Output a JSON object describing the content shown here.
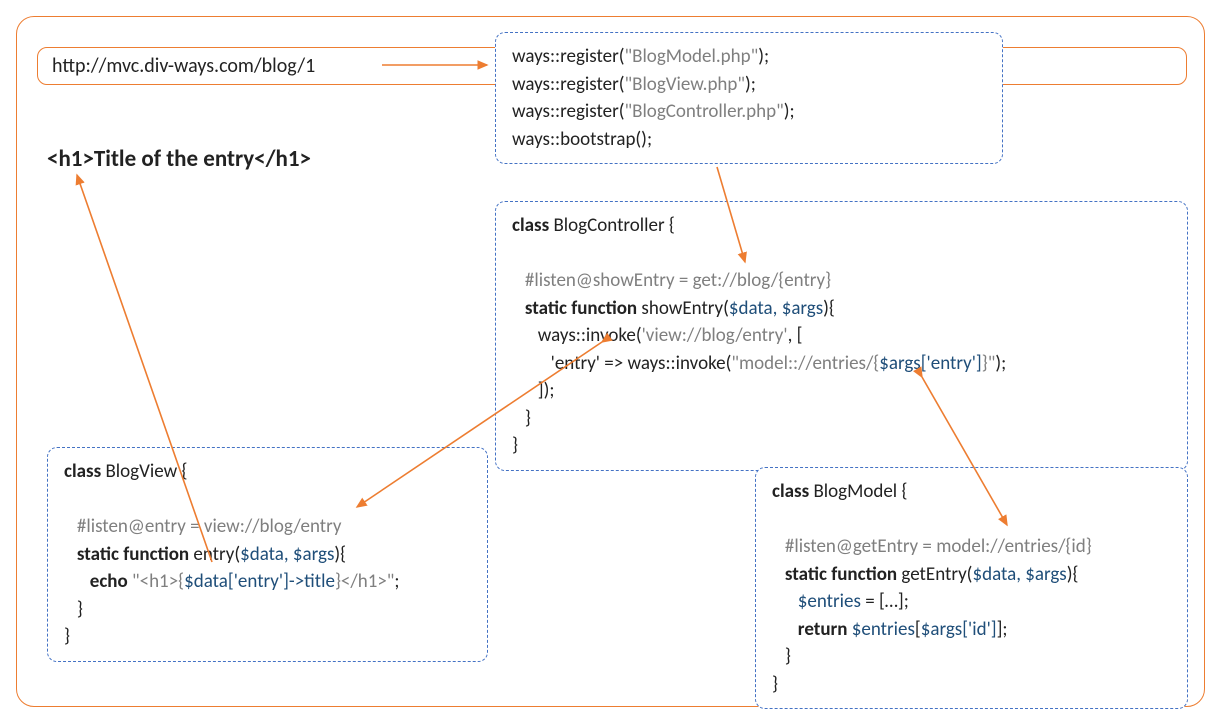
{
  "url": "http://mvc.div-ways.com/blog/1",
  "heading_full": "<h1>Title of the entry</h1>",
  "register": {
    "line1_pre": "ways::register(",
    "line1_str": "\"BlogModel.php\"",
    "line1_post": ");",
    "line2_pre": "ways::register(",
    "line2_str": "\"BlogView.php\"",
    "line2_post": ");",
    "line3_pre": "ways::register(",
    "line3_str": "\"BlogController.php\"",
    "line3_post": ");",
    "line4": "ways::bootstrap();"
  },
  "controller": {
    "class_kw": "class",
    "class_name": " BlogController {",
    "listen": "   #listen@showEntry = get://blog/{entry}",
    "fn_kw": "   static function",
    "fn_sig_plain": " showEntry(",
    "fn_args": "$data, $args",
    "fn_sig_close": "){",
    "invoke1_pre": "      ways::invoke(",
    "invoke1_str": "'view://blog/entry'",
    "invoke1_post": ", [",
    "invoke2_pre": "         'entry' => ways::invoke(",
    "invoke2_str1": "\"model:://entries/{",
    "invoke2_var": "$args['entry']",
    "invoke2_str2": "}\"",
    "invoke2_post": ");",
    "close1": "      ]);",
    "close2": "   }",
    "close3": "}"
  },
  "view": {
    "class_kw": "class",
    "class_name": " BlogView {",
    "listen": "   #listen@entry = view://blog/entry",
    "fn_kw": "   static function",
    "fn_name": " entry(",
    "fn_args": "$data, $args",
    "fn_close": "){",
    "echo_kw": "      echo ",
    "echo_str1": "\"<h1>{",
    "echo_var": "$data['entry']->title",
    "echo_str2": "}</h1>\"",
    "echo_post": ";",
    "close1": "   }",
    "close2": "}"
  },
  "model": {
    "class_kw": "class",
    "class_name": " BlogModel {",
    "listen": "   #listen@getEntry = model://entries/{id}",
    "fn_kw": "   static function",
    "fn_name": " getEntry(",
    "fn_args": "$data, $args",
    "fn_close": "){",
    "entries_var": "      $entries",
    "entries_rest": " = […];",
    "ret_kw": "      return ",
    "ret_var1": "$entries",
    "ret_plain1": "[",
    "ret_var2": "$args['id']",
    "ret_plain2": "];",
    "close1": "   }",
    "close2": "}"
  }
}
